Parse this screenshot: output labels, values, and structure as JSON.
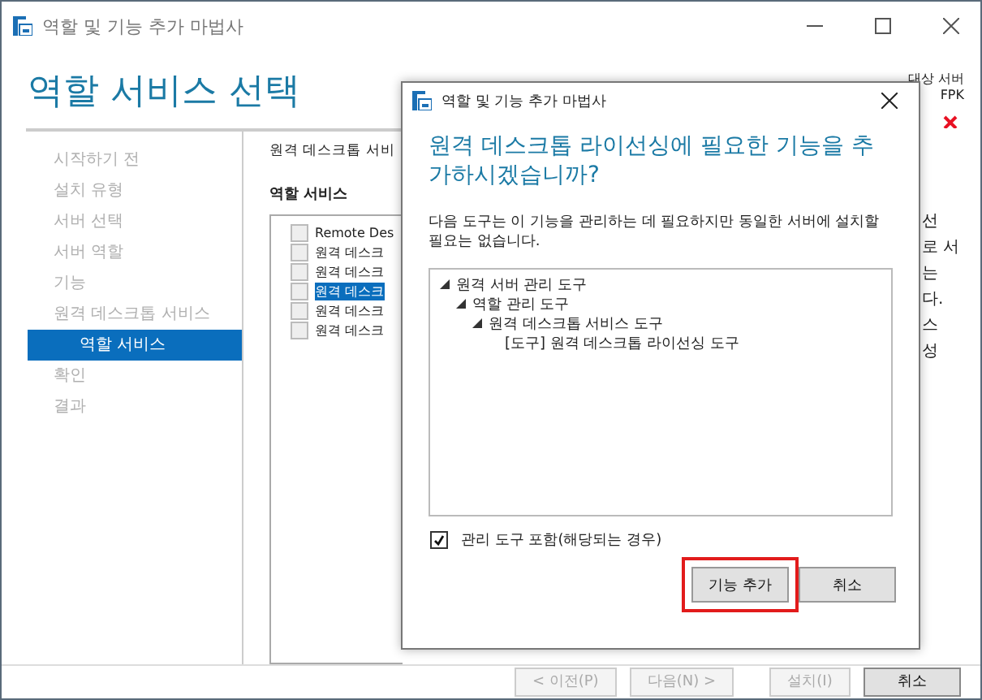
{
  "window": {
    "title": "역할 및 기능 추가 마법사"
  },
  "page_heading": "역할 서비스 선택",
  "target_server": {
    "label": "대상 서버",
    "value": "FPK",
    "error": true
  },
  "nav": [
    {
      "label": "시작하기 전",
      "selected": false
    },
    {
      "label": "설치 유형",
      "selected": false
    },
    {
      "label": "서버 선택",
      "selected": false
    },
    {
      "label": "서버 역할",
      "selected": false
    },
    {
      "label": "기능",
      "selected": false
    },
    {
      "label": "원격 데스크톱 서비스",
      "selected": false,
      "children": [
        {
          "label": "역할 서비스",
          "selected": true
        }
      ]
    },
    {
      "label": "확인",
      "selected": false
    },
    {
      "label": "결과",
      "selected": false
    }
  ],
  "content": {
    "title": "원격 데스크톱 서비",
    "list_label": "역할 서비스",
    "role_services": [
      {
        "label": "Remote Des",
        "checked": false,
        "selected": false
      },
      {
        "label": "원격 데스크",
        "checked": false,
        "selected": false
      },
      {
        "label": "원격 데스크",
        "checked": false,
        "selected": false
      },
      {
        "label": "원격 데스크",
        "checked": false,
        "selected": true
      },
      {
        "label": "원격 데스크",
        "checked": false,
        "selected": false
      },
      {
        "label": "원격 데스크",
        "checked": false,
        "selected": false
      }
    ]
  },
  "description_fragments": [
    "선",
    "로 서",
    "는",
    "다.",
    "스",
    "성"
  ],
  "footer_buttons": [
    {
      "label": "< 이전(P)",
      "disabled": true
    },
    {
      "label": "다음(N) >",
      "disabled": true
    },
    {
      "label": "설치(I)",
      "disabled": true
    },
    {
      "label": "취소",
      "disabled": false
    }
  ],
  "dialog": {
    "title": "역할 및 기능 추가 마법사",
    "heading": "원격 데스크톱 라이선싱에 필요한 기능을 추가하시겠습니까?",
    "description": "다음 도구는 이 기능을 관리하는 데 필요하지만 동일한 서버에 설치할 필요는 없습니다.",
    "tree": [
      {
        "label": "원격 서버 관리 도구",
        "expanded": true,
        "children": [
          {
            "label": "역할 관리 도구",
            "expanded": true,
            "children": [
              {
                "label": "원격 데스크톱 서비스 도구",
                "expanded": true,
                "children": [
                  {
                    "label": "[도구] 원격 데스크톱 라이선싱 도구"
                  }
                ]
              }
            ]
          }
        ]
      }
    ],
    "include_tools": {
      "label": "관리 도구 포함(해당되는 경우)",
      "checked": true
    },
    "buttons": [
      {
        "label": "기능 추가",
        "highlighted": true
      },
      {
        "label": "취소",
        "highlighted": false
      }
    ]
  }
}
